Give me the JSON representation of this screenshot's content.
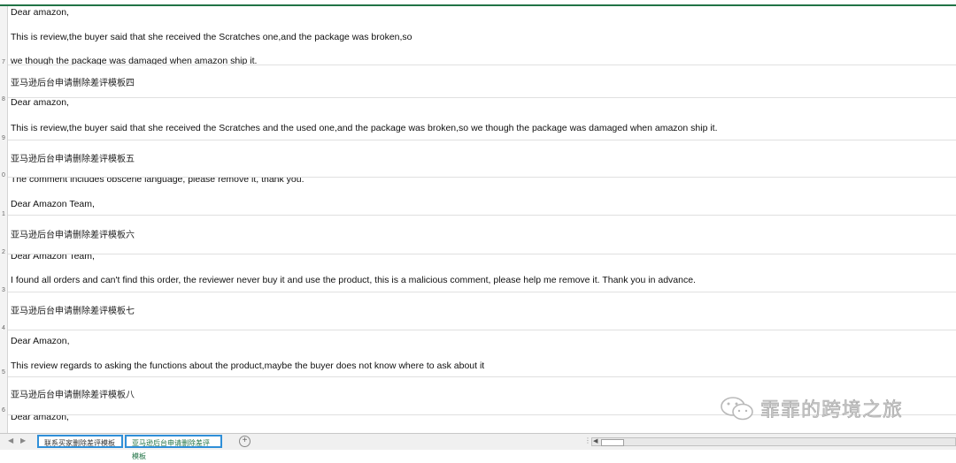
{
  "sheet": {
    "row_numbers": [
      "7",
      "8",
      "9",
      "0",
      "1",
      "2",
      "3",
      "4",
      "5",
      "6"
    ],
    "rows": [
      {
        "kind": "en",
        "lines": [
          "Dear amazon,",
          "This is review,the buyer said that she received the Scratches one,and the package was broken,so",
          "we though the package was damaged when amazon ship it."
        ]
      },
      {
        "kind": "cn",
        "lines": [
          "亚马逊后台申请删除差评模板四"
        ]
      },
      {
        "kind": "en",
        "lines": [
          "Dear amazon,",
          "This is review,the buyer said that she received the Scratches and the used one,and the package was broken,so we though the package was damaged when amazon ship it."
        ]
      },
      {
        "kind": "cn",
        "lines": [
          "亚马逊后台申请删除差评模板五"
        ]
      },
      {
        "kind": "en",
        "lines": [
          "The comment includes obscene language, please remove it, thank you.",
          "Dear Amazon Team,"
        ]
      },
      {
        "kind": "cn",
        "lines": [
          "亚马逊后台申请删除差评模板六"
        ]
      },
      {
        "kind": "en",
        "lines": [
          "Dear Amazon Team,",
          "I found all orders and can't find this order, the reviewer never buy it and use the product, this is a malicious comment, please help me remove it. Thank you in advance."
        ]
      },
      {
        "kind": "cn",
        "lines": [
          "亚马逊后台申请删除差评模板七"
        ]
      },
      {
        "kind": "en",
        "lines": [
          "Dear Amazon,",
          "This review regards to asking the functions about the product,maybe the buyer does not know where to ask about it"
        ]
      },
      {
        "kind": "cn",
        "lines": [
          "亚马逊后台申请删除差评模板八"
        ]
      },
      {
        "kind": "en",
        "lines": [
          "Dear amazon,"
        ]
      }
    ]
  },
  "tabs": [
    {
      "label": "联系买家删除差评模板",
      "active": false
    },
    {
      "label": "亚马逊后台申请删除差评模板",
      "active": true
    }
  ],
  "add_sheet_symbol": "+",
  "watermark": {
    "text": "霏霏的跨境之旅",
    "icon": "wechat-icon"
  },
  "colors": {
    "accent": "#217346",
    "tab_border": "#2f8fd8"
  }
}
